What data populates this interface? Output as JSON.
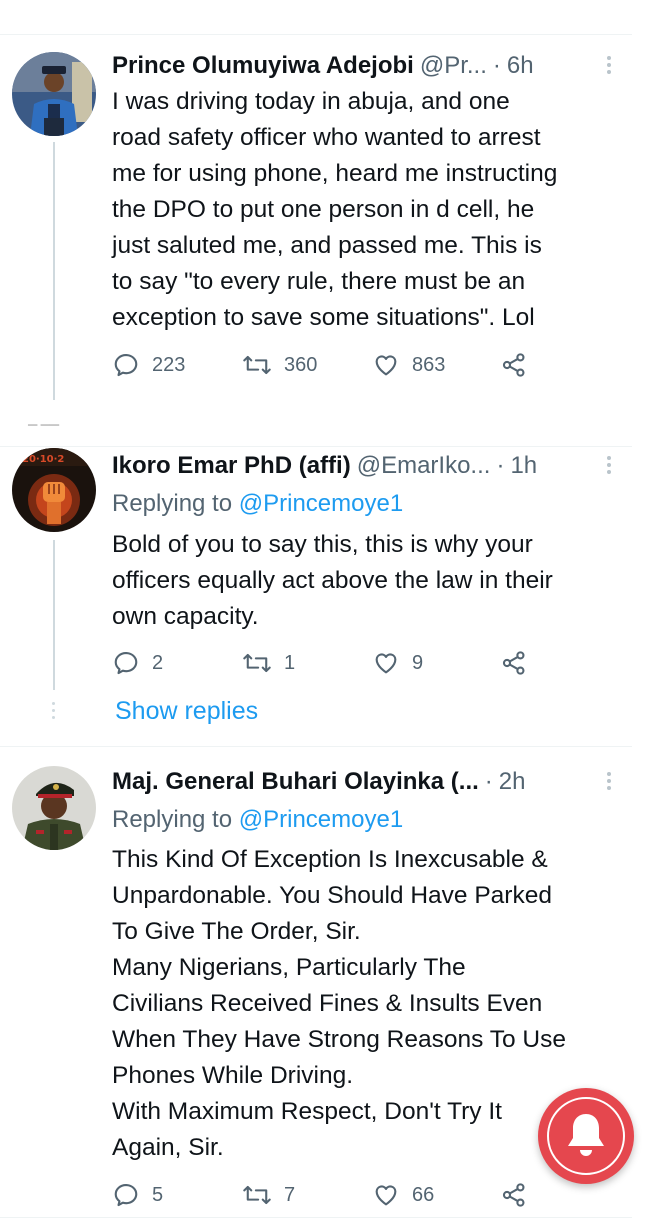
{
  "tweets": [
    {
      "name": "Prince Olumuyiwa Adejobi",
      "handle": "@Pr...",
      "time": "6h",
      "avatar_icon": "police-officer-avatar",
      "text_lines": [
        "I was driving today in abuja, and one",
        "road safety officer who wanted to arrest",
        "me for using phone, heard me instructing",
        "the DPO to put one person in d cell, he",
        "just saluted me, and passed me. This is",
        "to say \"to every rule, there must be an",
        "exception to save some situations\". Lol"
      ],
      "replies": "223",
      "retweets": "360",
      "likes": "863"
    },
    {
      "name": "Ikoro Emar PhD (affi)",
      "handle": "@EmarIko...",
      "time": "1h",
      "avatar_icon": "raised-fist-avatar",
      "replying_prefix": "Replying to",
      "replying_to": "@Princemoye1",
      "text_lines": [
        "Bold of you to say this, this is why your",
        "officers equally act above the law in their",
        "own capacity."
      ],
      "replies": "2",
      "retweets": "1",
      "likes": "9",
      "show_replies": "Show replies"
    },
    {
      "name": "Maj. General Buhari Olayinka (...",
      "handle": "",
      "time": "2h",
      "avatar_icon": "military-officer-avatar",
      "replying_prefix": "Replying to",
      "replying_to": "@Princemoye1",
      "text_lines": [
        "This Kind Of Exception Is Inexcusable &",
        "Unpardonable. You Should Have Parked",
        "To Give The Order, Sir.",
        "Many Nigerians, Particularly The",
        "Civilians Received Fines & Insults Even",
        "When They Have Strong Reasons To Use",
        "Phones While Driving.",
        "With Maximum Respect, Don't Try It",
        "Again, Sir."
      ],
      "replies": "5",
      "retweets": "7",
      "likes": "66"
    }
  ],
  "separator": "·",
  "colors": {
    "text": "#0f1419",
    "secondary": "#536471",
    "link": "#1d9bf0",
    "notification_button": "#e5474e"
  },
  "fab_icon": "notification-bell-icon"
}
